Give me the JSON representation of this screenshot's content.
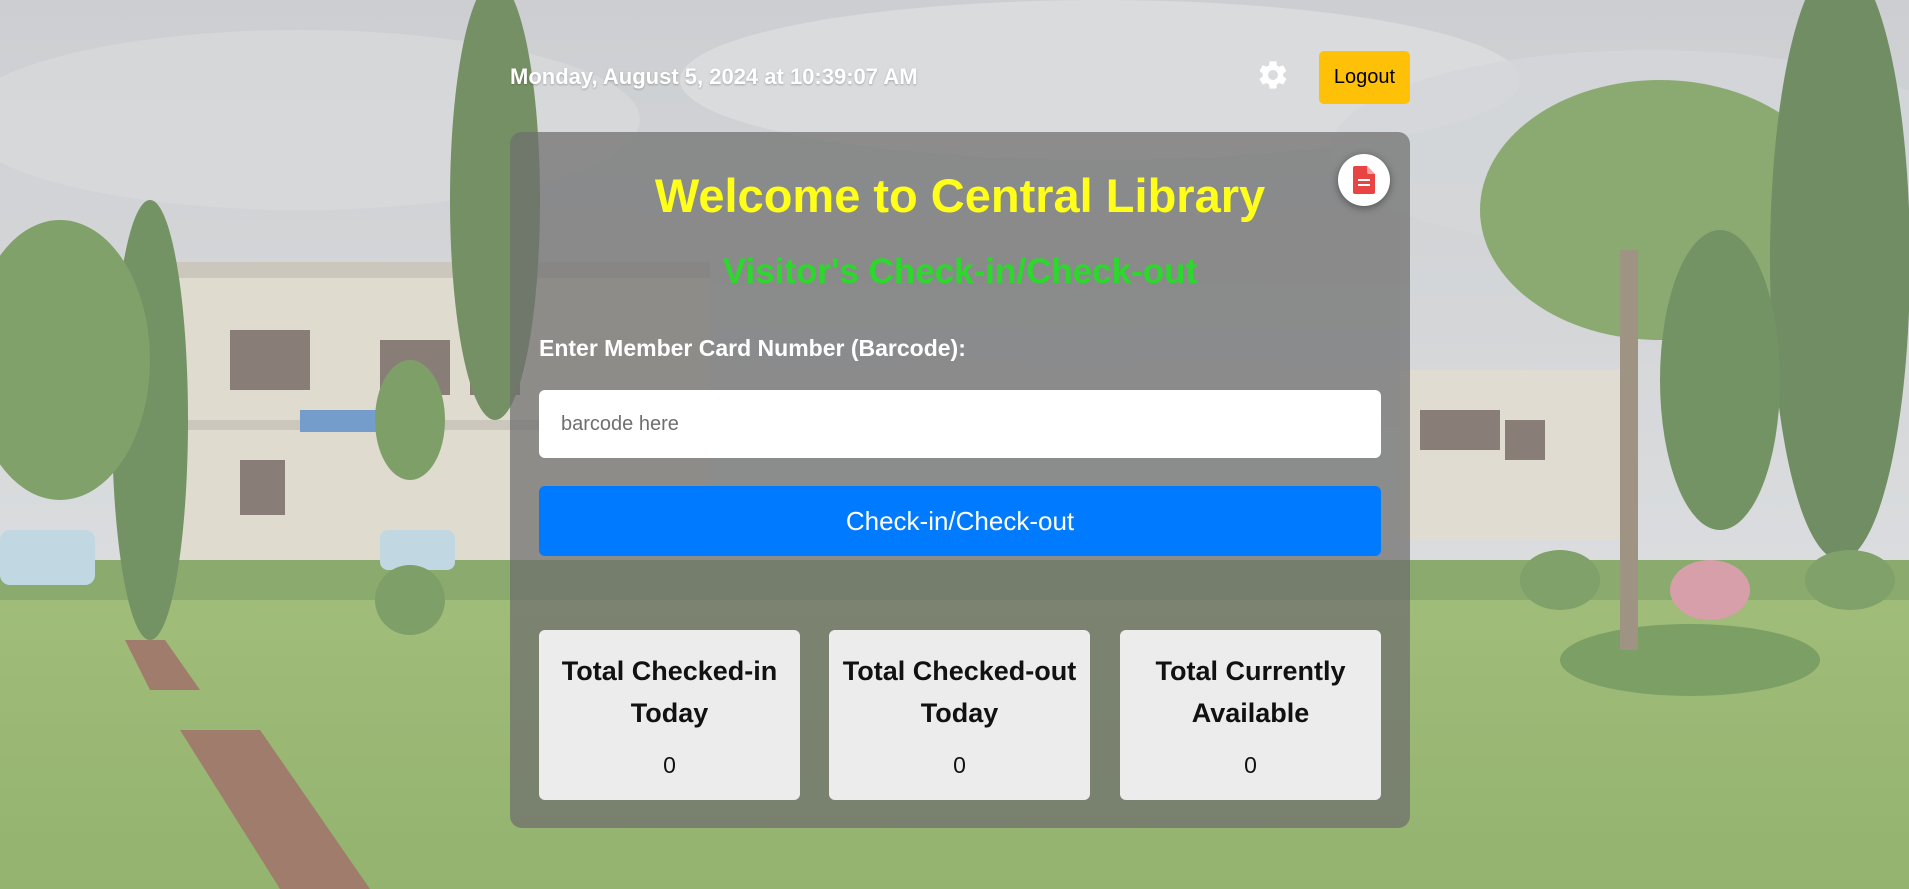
{
  "header": {
    "datetime": "Monday, August 5, 2024 at 10:39:07 AM",
    "settings_icon": "gear-icon",
    "logout_label": "Logout"
  },
  "main": {
    "report_icon": "document-icon",
    "title": "Welcome to Central Library",
    "subtitle": "Visitor's Check-in/Check-out",
    "barcode_label": "Enter Member Card Number (Barcode):",
    "barcode_placeholder": "barcode here",
    "barcode_value": "",
    "submit_label": "Check-in/Check-out"
  },
  "stats": [
    {
      "label": "Total Checked-in Today",
      "value": "0"
    },
    {
      "label": "Total Checked-out Today",
      "value": "0"
    },
    {
      "label": "Total Currently Available",
      "value": "0"
    }
  ],
  "colors": {
    "title": "#ffff1a",
    "subtitle": "#2bd82b",
    "primary_button": "#007bff",
    "logout_button": "#ffc107",
    "report_icon": "#e84444"
  }
}
